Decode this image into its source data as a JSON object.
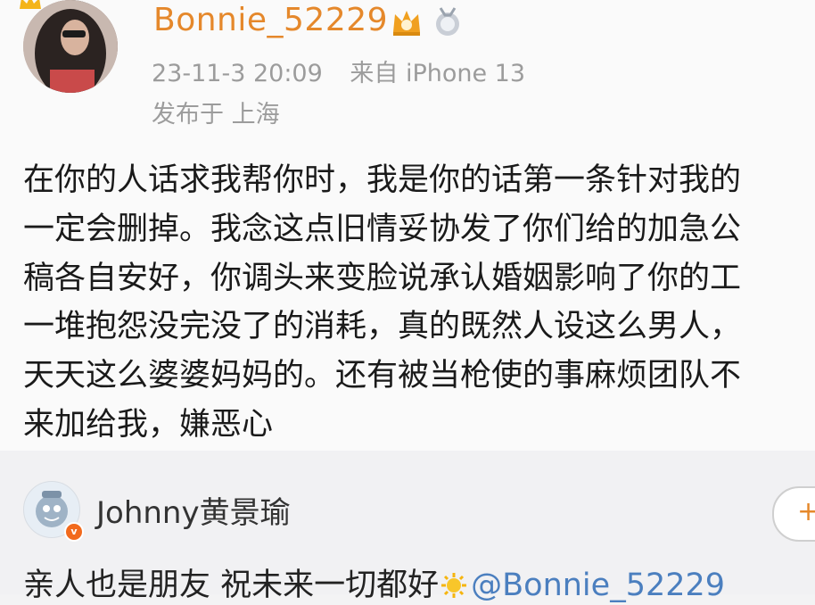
{
  "post": {
    "username": "Bonnie_52229",
    "timestamp": "23-11-3 20:09",
    "source": "来自 iPhone 13",
    "location": "发布于 上海",
    "lines": [
      "在你的人话求我帮你时，我是你的话第一条针对我的",
      "一定会删掉。我念这点旧情妥协发了你们给的加急公",
      "稿各自安好，你调头来变脸说承认婚姻影响了你的工",
      "一堆抱怨没完没了的消耗，真的既然人设这么男人，",
      "天天这么婆婆妈妈的。还有被当枪使的事麻烦团队不",
      "来加给我，嫌恶心"
    ]
  },
  "comment": {
    "username": "Johnny黄景瑜",
    "text_before": "亲人也是朋友 祝未来一切都好",
    "mention": "@Bonnie_52229",
    "follow_symbol": "+",
    "badge": "v"
  },
  "colors": {
    "username_orange": "#e5882b",
    "meta_gray": "#9c9c9c",
    "mention_blue": "#4b7fbf"
  },
  "icons": [
    "crown-badge-icon",
    "vip-crown-icon",
    "medal-icon",
    "sun-emoji-icon",
    "verified-badge-icon"
  ]
}
